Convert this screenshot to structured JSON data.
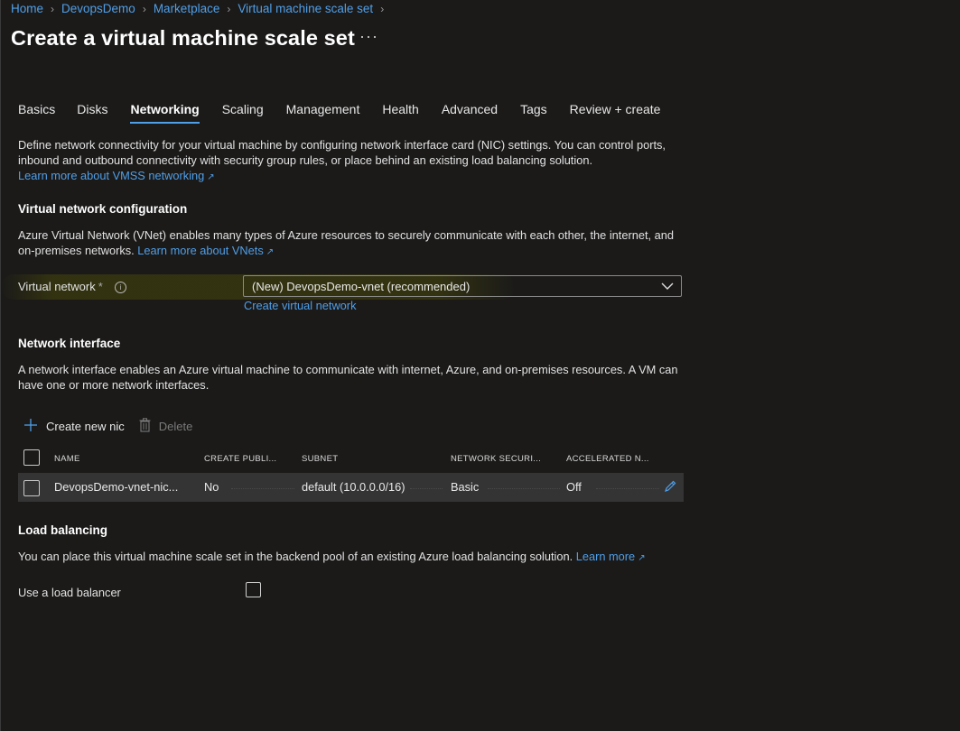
{
  "breadcrumb": [
    "Home",
    "DevopsDemo",
    "Marketplace",
    "Virtual machine scale set"
  ],
  "page_title": "Create a virtual machine scale set",
  "more_label": "···",
  "tabs": [
    {
      "label": "Basics",
      "active": false
    },
    {
      "label": "Disks",
      "active": false
    },
    {
      "label": "Networking",
      "active": true
    },
    {
      "label": "Scaling",
      "active": false
    },
    {
      "label": "Management",
      "active": false
    },
    {
      "label": "Health",
      "active": false
    },
    {
      "label": "Advanced",
      "active": false
    },
    {
      "label": "Tags",
      "active": false
    },
    {
      "label": "Review + create",
      "active": false
    }
  ],
  "intro": {
    "text": "Define network connectivity for your virtual machine by configuring network interface card (NIC) settings. You can control ports, inbound and outbound connectivity with security group rules, or place behind an existing load balancing solution.",
    "link": "Learn more about VMSS networking"
  },
  "vnet_section": {
    "heading": "Virtual network configuration",
    "text": "Azure Virtual Network (VNet) enables many types of Azure resources to securely communicate with each other, the internet, and on-premises networks.",
    "link": "Learn more about VNets",
    "field_label": "Virtual network",
    "required_mark": "*",
    "selected_value": "(New) DevopsDemo-vnet (recommended)",
    "create_link": "Create virtual network"
  },
  "nic_section": {
    "heading": "Network interface",
    "text": "A network interface enables an Azure virtual machine to communicate with internet, Azure, and on-premises resources. A VM can have one or more network interfaces.",
    "create_label": "Create new nic",
    "delete_label": "Delete",
    "columns": [
      "NAME",
      "CREATE PUBLI...",
      "SUBNET",
      "NETWORK SECURI...",
      "ACCELERATED N..."
    ],
    "rows": [
      {
        "name": "DevopsDemo-vnet-nic...",
        "public_ip": "No",
        "subnet": "default (10.0.0.0/16)",
        "nsg": "Basic",
        "accelerated": "Off"
      }
    ]
  },
  "lb_section": {
    "heading": "Load balancing",
    "text": "You can place this virtual machine scale set in the backend pool of an existing Azure load balancing solution.",
    "link": "Learn more",
    "checkbox_label": "Use a load balancer",
    "checked": false
  },
  "colors": {
    "background": "#1b1a19",
    "link": "#4f9fe8",
    "row_bg": "#343434"
  }
}
